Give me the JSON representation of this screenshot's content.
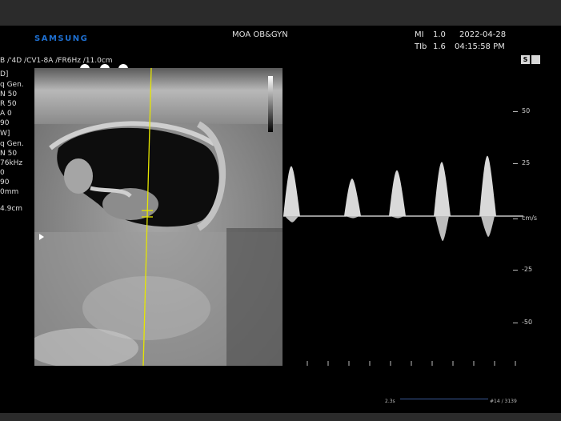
{
  "header": {
    "brand": "SAMSUNG",
    "facility": "MOA OB&GYN",
    "mi_label": "MI",
    "mi_value": "1.0",
    "tib_label": "TIb",
    "tib_value": "1.6",
    "date": "2022-04-28",
    "time": "04:15:58 PM"
  },
  "probe_line": "B /'4D /CV1-8A /FR6Hz /11.0cm",
  "side_panel": [
    {
      "text": "D]"
    },
    {
      "text": "q  Gen."
    },
    {
      "text": "N  50"
    },
    {
      "text": "R  50"
    },
    {
      "text": "A  0"
    },
    {
      "text": "   90"
    },
    {
      "text": "W]"
    },
    {
      "text": "q  Gen."
    },
    {
      "text": "N  50"
    },
    {
      "text": "76kHz"
    },
    {
      "text": "   0"
    },
    {
      "text": "   90"
    },
    {
      "text": "0mm"
    },
    {
      "text": "4.9cm"
    }
  ],
  "doppler": {
    "scale_labels": [
      "50",
      "25",
      "cm/s",
      "-25",
      "-50"
    ],
    "scale_values": [
      50,
      25,
      0,
      -25,
      -50
    ],
    "units": "cm/s",
    "peaks_up": [
      24,
      18,
      22,
      26,
      29
    ],
    "peaks_down": [
      3,
      1,
      1,
      12,
      10
    ]
  },
  "footer": {
    "left_time": "2.3s",
    "right_frame": "#14 / 3139"
  },
  "icons": [
    "settings-s-icon",
    "camera-icon",
    "cine-dot-icon"
  ]
}
